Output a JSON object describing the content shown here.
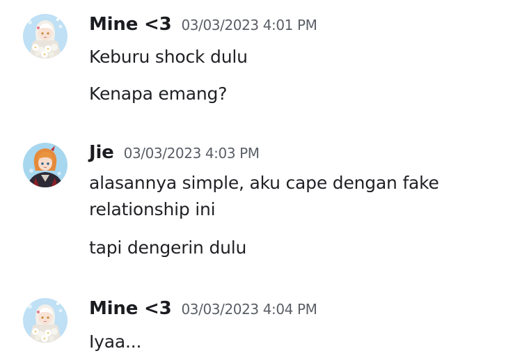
{
  "groups": [
    {
      "username": "Mine <3",
      "timestamp": "03/03/2023 4:01 PM",
      "avatar_icon": "white-haired-character-with-flowers-avatar",
      "messages": [
        "Keburu shock dulu",
        "Kenapa emang?"
      ]
    },
    {
      "username": "Jie",
      "timestamp": "03/03/2023 4:03 PM",
      "avatar_icon": "orange-haired-character-avatar",
      "messages": [
        "alasannya simple, aku cape dengan fake relationship ini",
        "tapi dengerin dulu"
      ]
    },
    {
      "username": "Mine <3",
      "timestamp": "03/03/2023 4:04 PM",
      "avatar_icon": "white-haired-character-with-flowers-avatar",
      "messages": [
        "Iyaa..."
      ]
    }
  ],
  "colors": {
    "username": "#1b1c20",
    "timestamp": "#5a5e66",
    "message_text": "#1f2024",
    "background": "#ffffff"
  }
}
